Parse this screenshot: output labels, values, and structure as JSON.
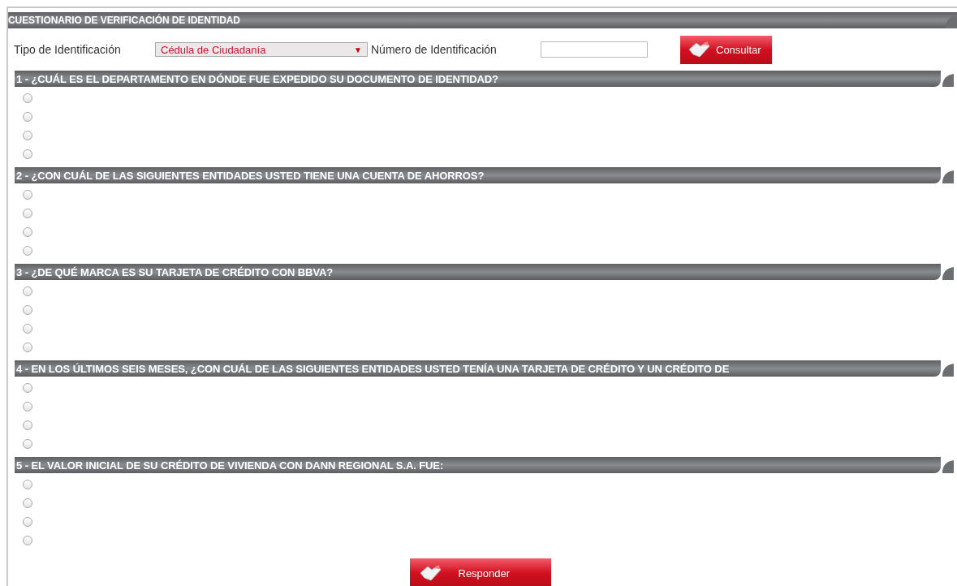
{
  "header": {
    "title": "CUESTIONARIO DE VERIFICACIÓN DE IDENTIDAD"
  },
  "form": {
    "id_type_label": "Tipo de Identificación",
    "id_type_value": "Cédula de Ciudadanía",
    "dropdown_arrow": "▼",
    "id_number_label": "Número de Identificación",
    "submit": "Consultar"
  },
  "questions": [
    {
      "title": "1 - ¿CUÁL ES EL DEPARTAMENTO EN DÓNDE FUE EXPEDIDO SU DOCUMENTO DE IDENTIDAD?",
      "options": [
        {
          "selected": false
        },
        {
          "selected": false
        },
        {
          "selected": false
        },
        {
          "selected": false
        }
      ]
    },
    {
      "title": "2 - ¿CON CUÁL DE LAS SIGUIENTES ENTIDADES USTED TIENE UNA CUENTA DE AHORROS?",
      "options": [
        {
          "selected": false
        },
        {
          "selected": false
        },
        {
          "selected": false
        },
        {
          "selected": false
        }
      ]
    },
    {
      "title": "3 - ¿DE QUÉ MARCA ES SU TARJETA DE CRÉDITO CON BBVA?",
      "options": [
        {
          "selected": false
        },
        {
          "selected": false
        },
        {
          "selected": false
        },
        {
          "selected": false
        }
      ]
    },
    {
      "title": "4 - EN LOS ÚLTIMOS SEIS MESES, ¿CON CUÁL DE LAS SIGUIENTES ENTIDADES USTED TENÍA UNA TARJETA DE CRÉDITO Y UN CRÉDITO DE",
      "options": [
        {
          "selected": false
        },
        {
          "selected": false
        },
        {
          "selected": false
        },
        {
          "selected": false
        }
      ]
    },
    {
      "title": "5 - EL VALOR INICIAL DE SU CRÉDITO DE VIVIENDA CON DANN REGIONAL S.A. FUE:",
      "options": [
        {
          "selected": false
        },
        {
          "selected": false
        },
        {
          "selected": false
        },
        {
          "selected": false
        }
      ]
    }
  ],
  "answer_button": "Responder"
}
